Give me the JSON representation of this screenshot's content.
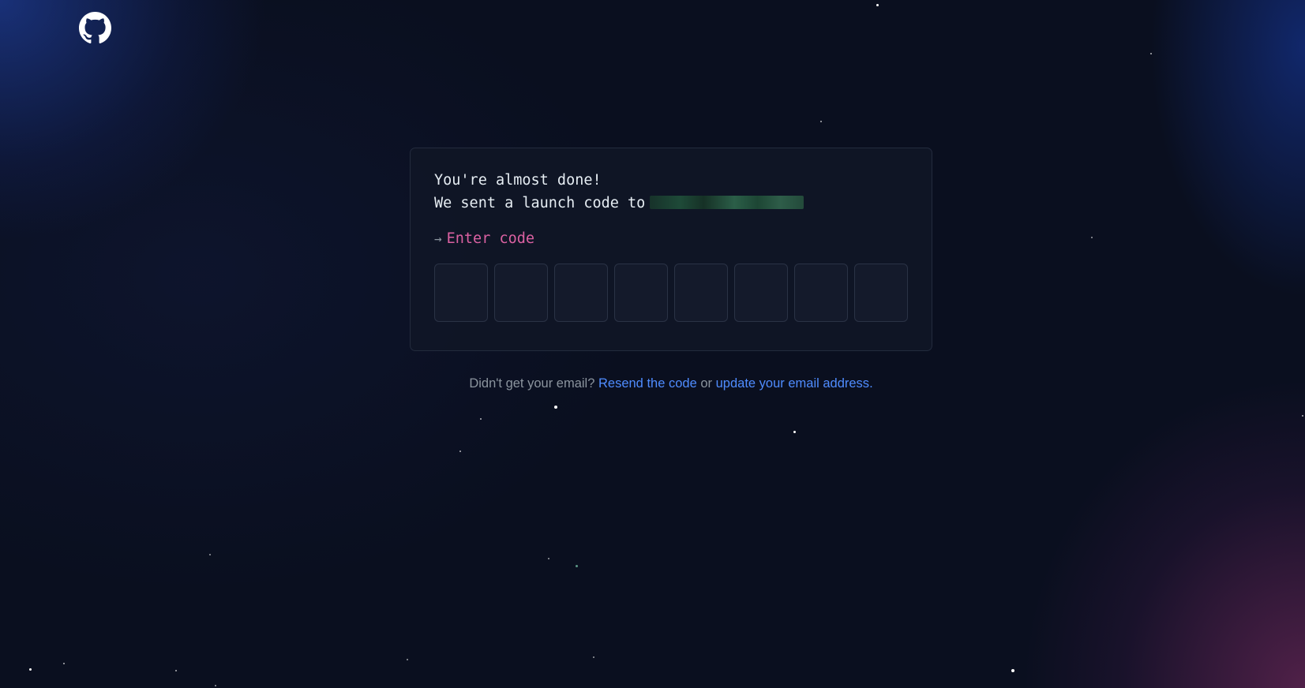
{
  "logo": {
    "icon": "github-logo-icon"
  },
  "card": {
    "line1": "You're almost done!",
    "line2": "We sent a launch code to",
    "email_redacted": "",
    "prompt_arrow": "→",
    "prompt_label": "Enter code",
    "code_boxes": 8
  },
  "footer": {
    "text_before": "Didn't get your email?",
    "resend_link": "Resend the code",
    "text_middle": "or",
    "update_link": "update your email address",
    "text_after": "."
  },
  "colors": {
    "prompt": "#db61a2",
    "link": "#4f8cff",
    "background": "#0a0f1f"
  }
}
